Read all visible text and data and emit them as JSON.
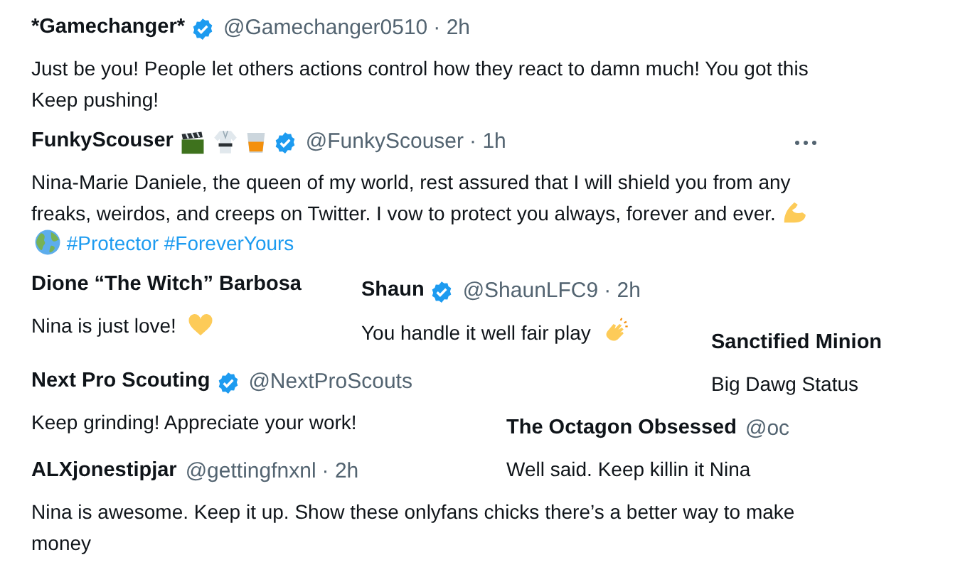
{
  "replies": [
    {
      "name": "*Gamechanger*",
      "verified": true,
      "handle": "@Gamechanger0510",
      "time": "· 2h",
      "text": "Just be you! People let others actions control how they react to damn much! You got this Keep pushing!"
    },
    {
      "name": "FunkyScouser",
      "verified": true,
      "handle": "@FunkyScouser",
      "time": "· 1h",
      "more_menu": true,
      "text": "Nina-Marie Daniele, the queen of my world, rest assured that I will shield you from any freaks, weirdos, and creeps on Twitter. I vow to protect you always, forever and ever.",
      "hashtags": [
        "#Protector",
        "#ForeverYours"
      ]
    },
    {
      "name": "Dione “The Witch” Barbosa",
      "verified": false,
      "text": "Nina is just love!"
    },
    {
      "name": "Shaun",
      "verified": true,
      "handle": "@ShaunLFC9",
      "time": "· 2h",
      "text": "You handle it well fair play"
    },
    {
      "name": "Sanctified Minion",
      "verified": false,
      "text": "Big Dawg Status"
    },
    {
      "name": "Next Pro Scouting",
      "verified": true,
      "handle": "@NextProScouts",
      "text": "Keep grinding! Appreciate your work!"
    },
    {
      "name": "The Octagon Obsessed",
      "verified": false,
      "handle": "@oc",
      "text": "Well said. Keep killin it Nina"
    },
    {
      "name": "ALXjonestipjar",
      "verified": false,
      "handle": "@gettingfnxnl",
      "time": "· 2h",
      "text": "Nina is awesome. Keep it up. Show these onlyfans chicks there’s a better way to make money"
    }
  ]
}
